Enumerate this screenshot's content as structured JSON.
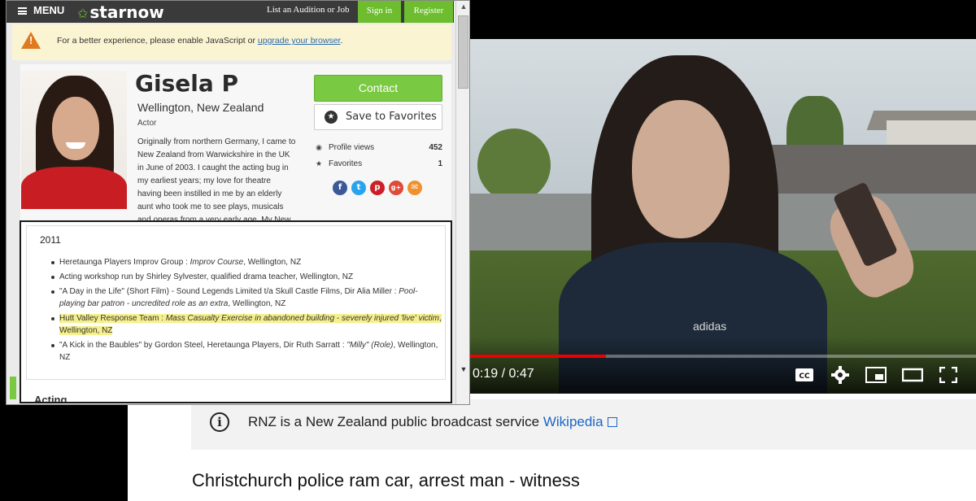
{
  "starnow": {
    "nav": {
      "menu_label": "MENU",
      "logo_text": "starnow",
      "list_audition": "List an Audition or Job",
      "sign_in": "Sign in",
      "register": "Register"
    },
    "warning": {
      "text": "For a better experience, please enable JavaScript or",
      "link": "upgrade your browser",
      "end": "."
    },
    "profile": {
      "name": "Gisela P",
      "location": "Wellington, New Zealand",
      "role": "Actor",
      "bio": "Originally from northern Germany, I came to New Zealand from Warwickshire in the UK in June of 2003. I caught the acting bug in my earliest years; my love for theatre having been instilled in me by an elderly aunt who took me to see plays, musicals and operas from a very early age. My New"
    },
    "actions": {
      "contact": "Contact",
      "save_favorites": "Save to Favorites"
    },
    "stats": [
      {
        "label": "Profile views",
        "value": "452",
        "icon": "eye-icon"
      },
      {
        "label": "Favorites",
        "value": "1",
        "icon": "star-icon"
      }
    ],
    "social": [
      {
        "name": "facebook-icon",
        "glyph": "f",
        "color": "#3b5998"
      },
      {
        "name": "twitter-icon",
        "glyph": "t",
        "color": "#2aa3ef"
      },
      {
        "name": "pinterest-icon",
        "glyph": "p",
        "color": "#cb2027"
      },
      {
        "name": "googleplus-icon",
        "glyph": "g+",
        "color": "#dd4b39"
      },
      {
        "name": "email-icon",
        "glyph": "✉",
        "color": "#f0912e"
      }
    ],
    "credits": {
      "year": "2011",
      "items": [
        {
          "pre": "Heretaunga Players Improv Group : ",
          "role": "Improv Course",
          "post": ", Wellington, NZ"
        },
        {
          "pre": "Acting workshop run by Shirley Sylvester, qualified drama teacher, Wellington, NZ",
          "role": "",
          "post": ""
        },
        {
          "pre": "\"A Day in the Life\" (Short Film) - Sound Legends Limited t/a Skull Castle Films, Dir Alia Miller : ",
          "role": "Pool-playing bar patron - uncredited role as an extra",
          "post": ", Wellington, NZ"
        },
        {
          "pre": "Hutt Valley Response Team : ",
          "role": "Mass Casualty Exercise in abandoned building - severely injured 'live' victim",
          "post": ", Wellington, NZ"
        },
        {
          "pre": "\"A Kick in the Baubles\" by Gordon Steel, Heretaunga Players, Dir Ruth Sarratt : ",
          "role": "\"Milly\" (Role)",
          "post": ", Wellington, NZ"
        }
      ],
      "next_section": "Acting"
    }
  },
  "youtube": {
    "player": {
      "time_label": "0:19 / 0:47",
      "progress_fraction": 0.27,
      "shirt_logo": "adidas",
      "controls": [
        "cc-icon",
        "settings-gear-icon",
        "miniplayer-icon",
        "theater-mode-icon",
        "fullscreen-icon"
      ]
    },
    "info_panel": {
      "text": "RNZ is a New Zealand public broadcast service",
      "link": "Wikipedia"
    },
    "video_title": "Christchurch police ram car, arrest man - witness"
  },
  "colors": {
    "starnow_green": "#7ac943",
    "youtube_red": "#ee0000",
    "link_blue": "#1a66c6",
    "highlight": "#f6f08c"
  }
}
